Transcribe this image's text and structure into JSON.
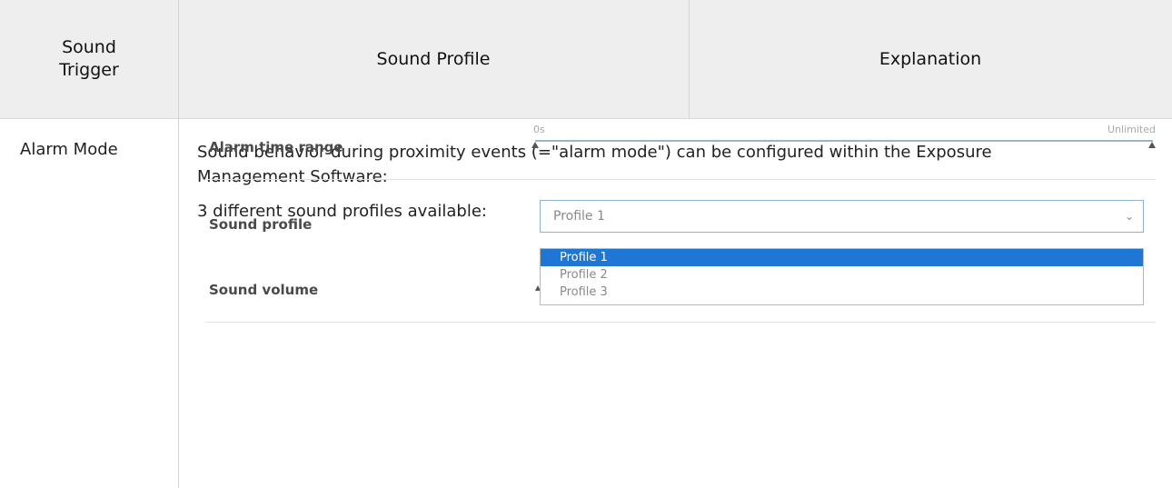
{
  "table": {
    "headers": [
      "Sound\nTrigger",
      "Sound Profile",
      "Explanation"
    ],
    "rows": [
      {
        "trigger": "Alarm Mode",
        "description": "Sound behavior during proximity events (=\"alarm mode\") can be configured within the Exposure Management Software:",
        "available": "3 different sound profiles available:"
      }
    ]
  },
  "settings": {
    "alarm_time_range_label": "Alarm time range",
    "range_min": "0s",
    "range_max": "Unlimited",
    "sound_profile_label": "Sound profile",
    "sound_profile_value": "Profile 1",
    "sound_volume_label": "Sound volume",
    "options": [
      "Profile 1",
      "Profile 2",
      "Profile 3"
    ],
    "selected_option": "Profile 1",
    "highlight_color": "#1e77d4"
  }
}
